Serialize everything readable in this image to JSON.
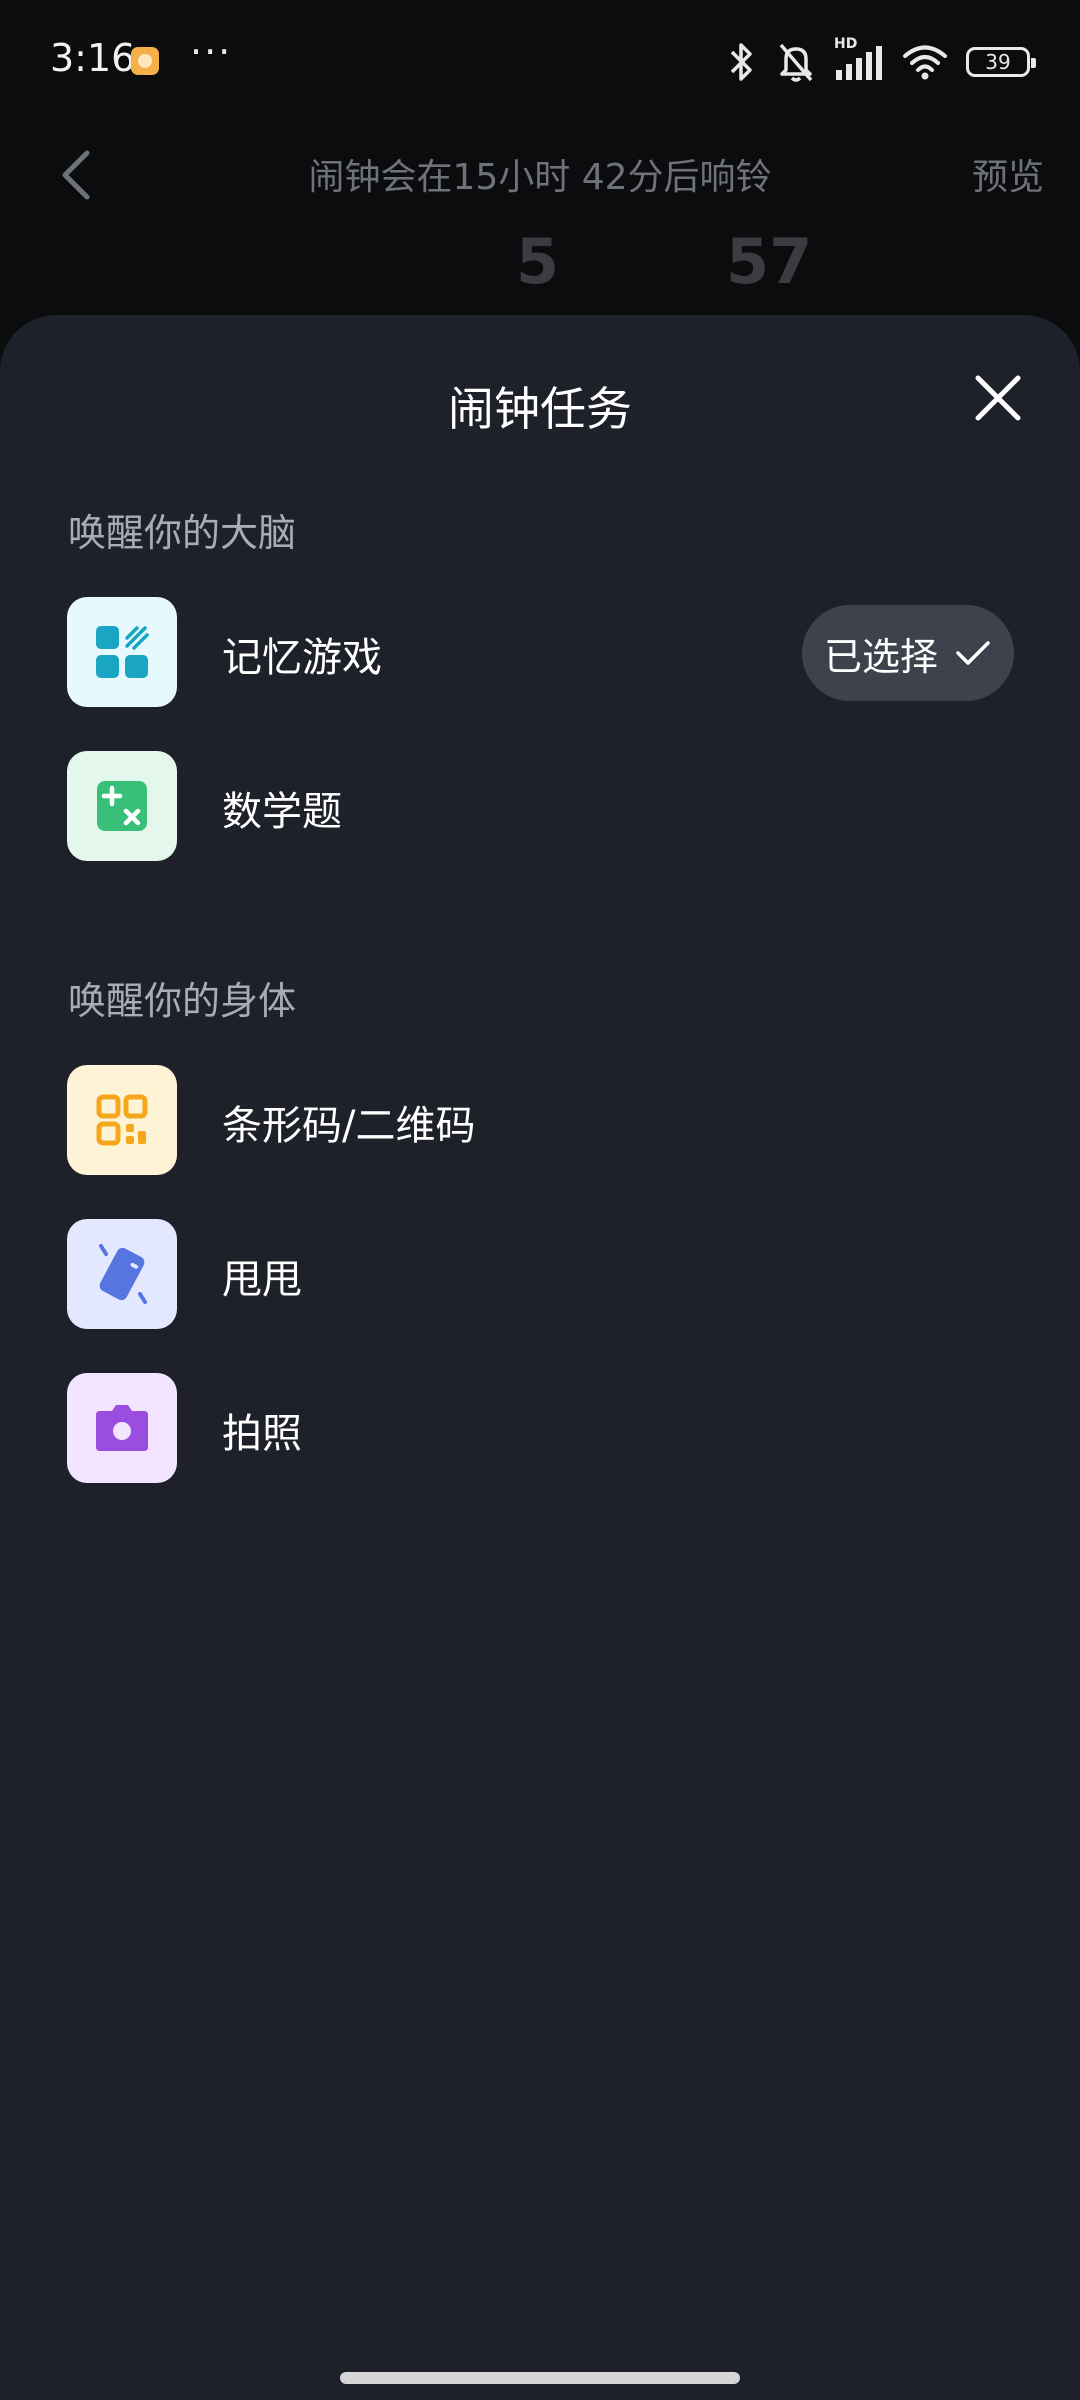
{
  "status_bar": {
    "time": "3:16",
    "more": "···",
    "network_label": "HD",
    "battery": "39"
  },
  "background": {
    "title": "闹钟会在15小时 42分后响铃",
    "preview": "预览",
    "hour_peek": "5",
    "minute_peek": "57"
  },
  "sheet": {
    "title": "闹钟任务",
    "sections": [
      {
        "header": "唤醒你的大脑",
        "items": [
          {
            "label": "记忆游戏",
            "icon": "memory-game-icon",
            "selected": true
          },
          {
            "label": "数学题",
            "icon": "math-icon",
            "selected": false
          }
        ]
      },
      {
        "header": "唤醒你的身体",
        "items": [
          {
            "label": "条形码/二维码",
            "icon": "qr-code-icon",
            "selected": false
          },
          {
            "label": "甩甩",
            "icon": "shake-phone-icon",
            "selected": false
          },
          {
            "label": "拍照",
            "icon": "camera-icon",
            "selected": false
          }
        ]
      }
    ],
    "selected_label": "已选择"
  },
  "colors": {
    "sheet_bg": "#1e212a",
    "memory_tile": "#e6f9fd",
    "memory_glyph": "#1aa5c3",
    "math_tile": "#e3f7ec",
    "math_glyph": "#38c078",
    "qr_tile": "#fff3d6",
    "qr_glyph": "#f4a71c",
    "shake_tile": "#e4e8ff",
    "shake_glyph": "#5675e0",
    "camera_tile": "#f3e4ff",
    "camera_glyph": "#9a4ddf"
  }
}
